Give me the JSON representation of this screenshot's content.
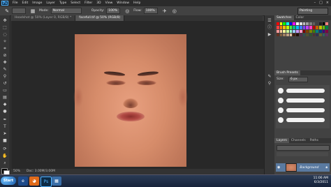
{
  "menu": [
    "File",
    "Edit",
    "Image",
    "Layer",
    "Type",
    "Select",
    "Filter",
    "3D",
    "View",
    "Window",
    "Help"
  ],
  "app_logo": "Ps",
  "window_controls": [
    "–",
    "□",
    "×"
  ],
  "options": {
    "mode_label": "Mode:",
    "mode_value": "Normal",
    "opacity_label": "Opacity:",
    "opacity_value": "100%",
    "flow_label": "Flow:",
    "flow_value": "100%",
    "workspace": "Painting"
  },
  "tabs": [
    {
      "label": "Headshot @ 50% (Layer 0, RGB/8) *",
      "active": false
    },
    {
      "label": "facefull.tif @ 50% (RGB/8)",
      "active": true
    }
  ],
  "status": {
    "zoom": "50%",
    "doc": "Doc: 3.00M/3.00M"
  },
  "panels": {
    "swatches_tabs": [
      "Swatches",
      "Color"
    ],
    "brush_tabs": [
      "Brush Presets"
    ],
    "brush_size_label": "Size:",
    "brush_size_value": "6 px",
    "layers_tabs": [
      "Layers",
      "Channels",
      "Paths"
    ],
    "layer_name": "Background"
  },
  "swatch_colors": [
    "#ff0000",
    "#ffff00",
    "#00ff00",
    "#00ffff",
    "#0000ff",
    "#ff00ff",
    "#ffffff",
    "#e0e0e0",
    "#c0c0c0",
    "#a0a0a0",
    "#808080",
    "#606060",
    "#404040",
    "#202020",
    "#000000",
    "#ff8080",
    "#ff4040",
    "#ff8000",
    "#ffc000",
    "#c0ff00",
    "#40ff40",
    "#00c080",
    "#00c0ff",
    "#4080ff",
    "#8040ff",
    "#c040ff",
    "#ff40c0",
    "#c00000",
    "#c06000",
    "#c0c000",
    "#60c000",
    "#008040",
    "#ff9999",
    "#ffcc99",
    "#ffff99",
    "#ccff99",
    "#99ffcc",
    "#99ccff",
    "#cc99ff",
    "#ff99cc",
    "#800000",
    "#804000",
    "#808000",
    "#408000",
    "#008080",
    "#004080",
    "#400080",
    "#800040",
    "#603020",
    "#806040",
    "#a08060",
    "#c0a080",
    "#e0c0a0",
    "#402010",
    "#201008",
    "#503050",
    "#305050",
    "#505030",
    "#305030",
    "#503030",
    "#303050",
    "#606030",
    "#306060",
    "#603060"
  ],
  "clock": {
    "time": "11:06 AM",
    "date": "6/3/2011"
  },
  "taskbar_start": "Start"
}
